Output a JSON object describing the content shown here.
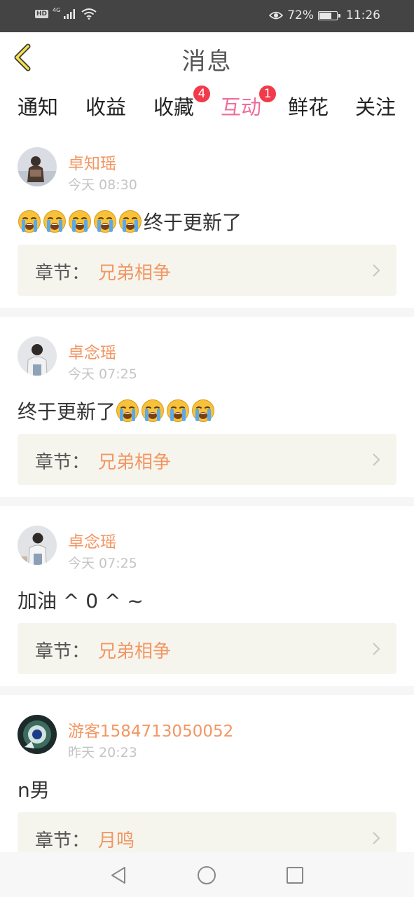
{
  "status_bar": {
    "hd": "HD",
    "network": "4G",
    "battery_percent": "72%",
    "battery_level": 0.72,
    "time": "11:26",
    "icons": [
      "signal-icon",
      "wifi-icon",
      "eye-icon",
      "battery-icon"
    ]
  },
  "header": {
    "title": "消息",
    "back_icon": "chevron-left-icon"
  },
  "tabs": [
    {
      "label": "通知",
      "badge": ""
    },
    {
      "label": "收益",
      "badge": ""
    },
    {
      "label": "收藏",
      "badge": "4"
    },
    {
      "label": "互动",
      "badge": "1",
      "active": true
    },
    {
      "label": "鲜花",
      "badge": ""
    },
    {
      "label": "关注",
      "badge": ""
    }
  ],
  "messages": [
    {
      "username": "卓知瑶",
      "time": "今天 08:30",
      "emoji_count": 5,
      "text": "终于更新了",
      "chapter_label": "章节：",
      "chapter_name": "兄弟相争"
    },
    {
      "username": "卓念瑶",
      "time": "今天 07:25",
      "text": "终于更新了",
      "emoji_count": 4,
      "chapter_label": "章节：",
      "chapter_name": "兄弟相争"
    },
    {
      "username": "卓念瑶",
      "time": "今天 07:25",
      "text": "加油 ^ 0 ^ ~",
      "chapter_label": "章节：",
      "chapter_name": "兄弟相争"
    },
    {
      "username": "游客1584713050052",
      "time": "昨天 20:23",
      "text": "n男",
      "chapter_label": "章节：",
      "chapter_name": "月鸣"
    }
  ],
  "nav_bar": {
    "icons": [
      "back-triangle-icon",
      "home-circle-icon",
      "recents-square-icon"
    ]
  },
  "colors": {
    "accent_pink": "#f06d9a",
    "username_orange": "#f39662",
    "badge_red": "#f23a4a",
    "status_bar": "#444444"
  }
}
